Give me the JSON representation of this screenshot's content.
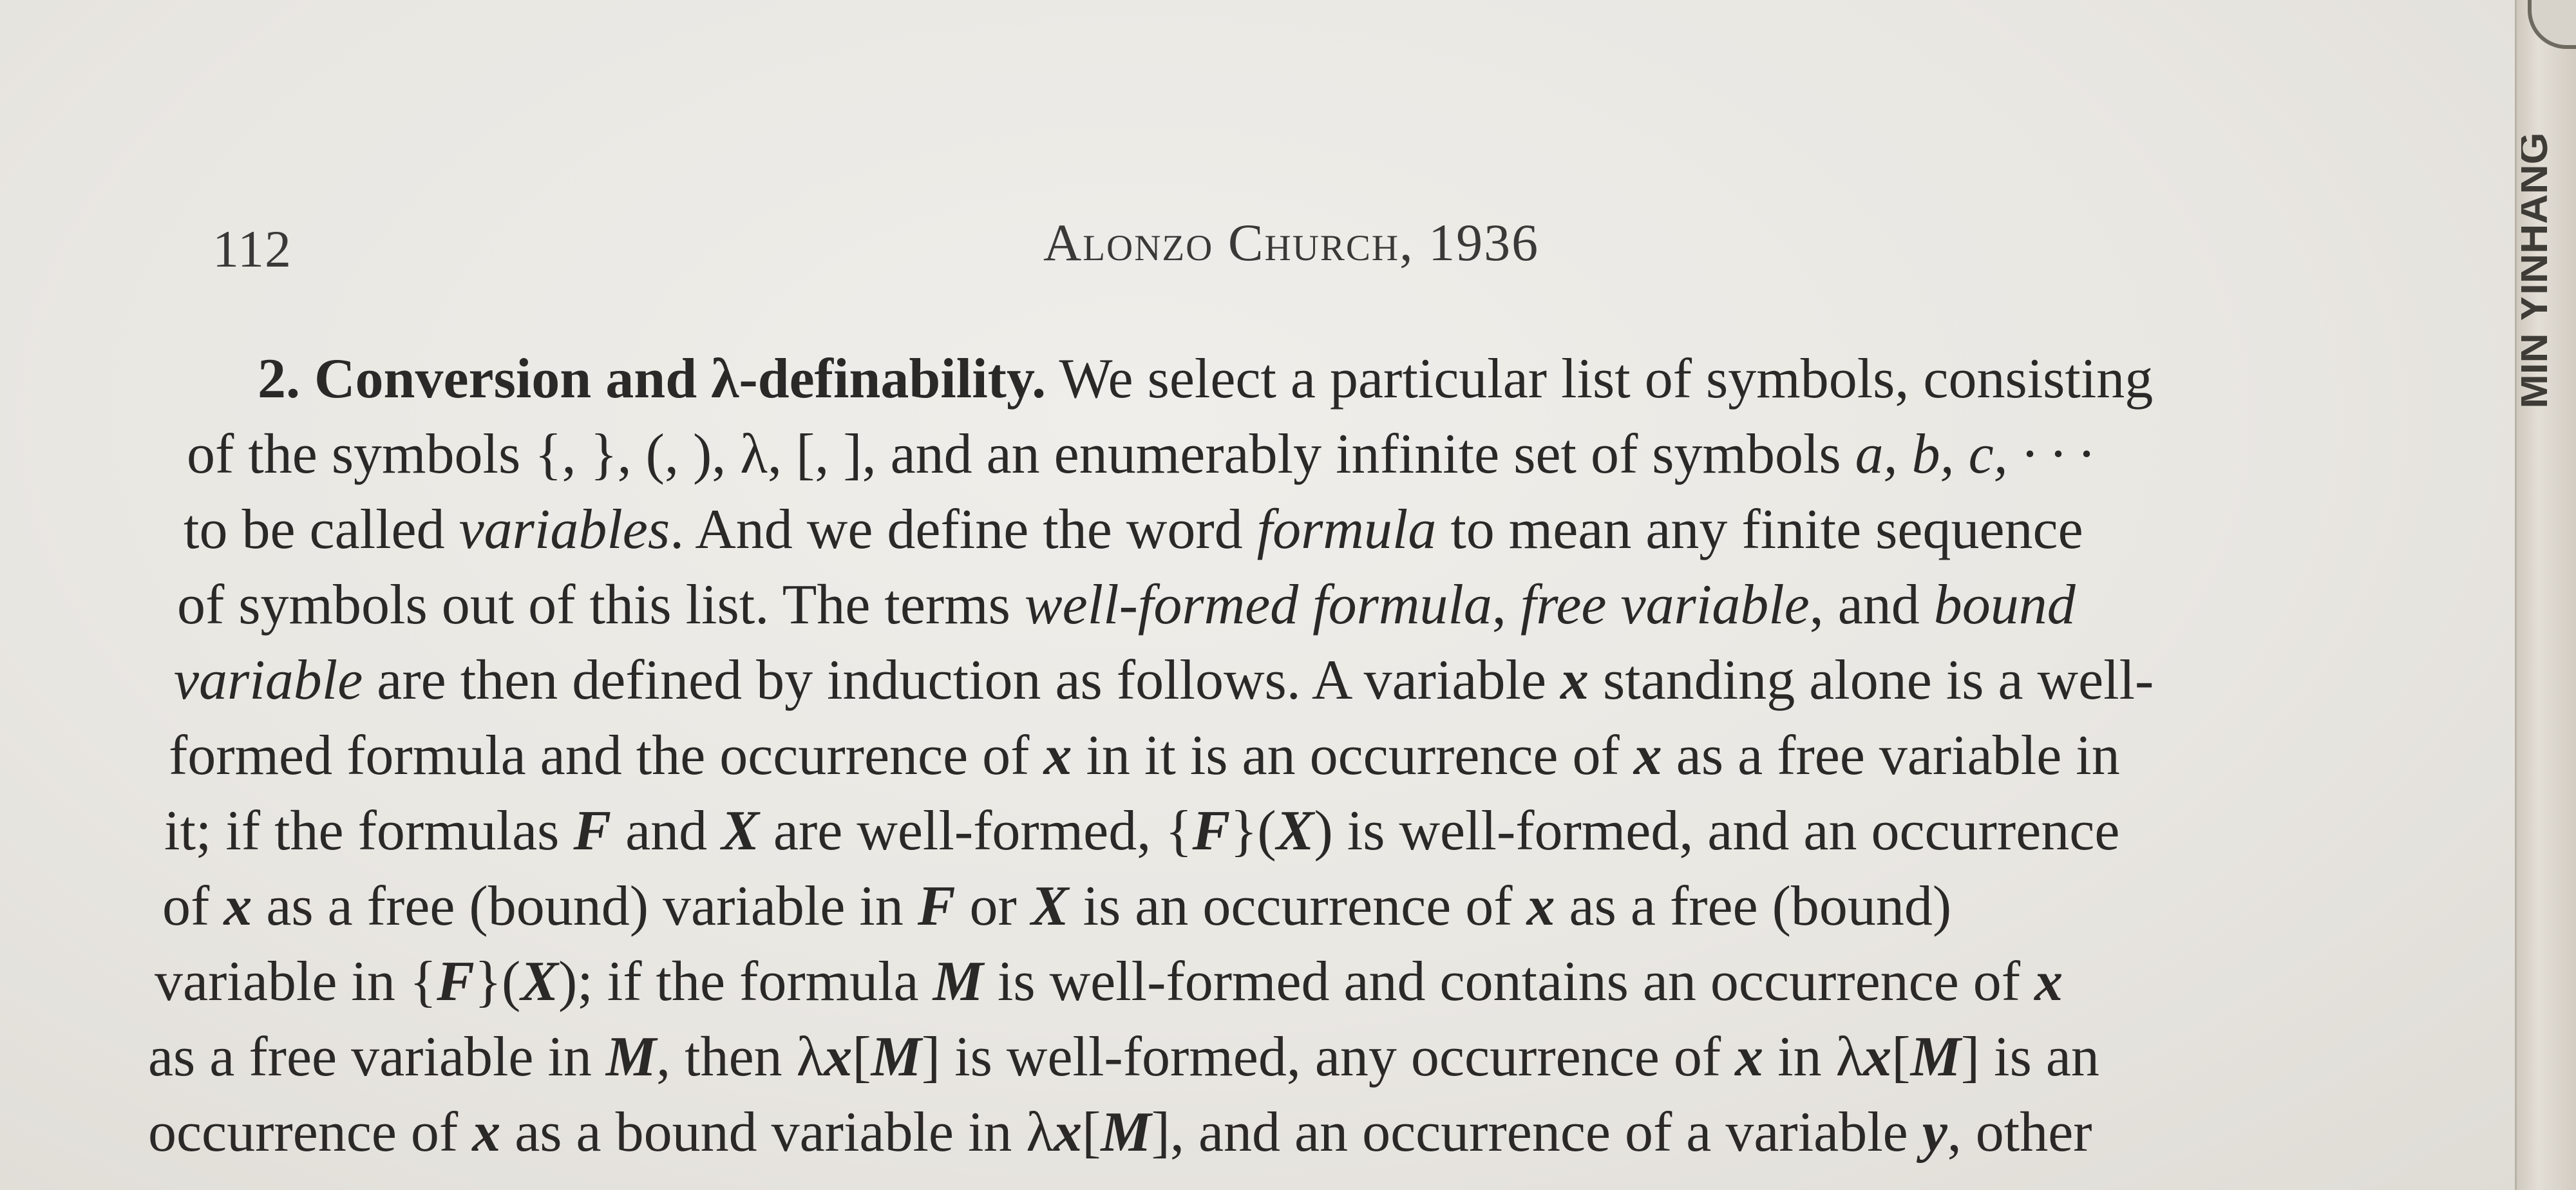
{
  "header": {
    "page_number": "112",
    "running_head": "Alonzo Church, 1936"
  },
  "text": {
    "l1_section_number": "2.",
    "l1_section_title": "Conversion and λ-definability.",
    "l1_rest": "We select a particular list of symbols, consisting",
    "l2_a": "of the symbols {, }, (, ), λ, [, ], and an enumerably infinite set of symbols ",
    "l2_b": "a, b, c, · · ·",
    "l3_a": "to be called ",
    "l3_b": "variables",
    "l3_c": ". And we define the word ",
    "l3_d": "formula",
    "l3_e": " to mean any finite sequence",
    "l4_a": "of symbols out of this list. The terms ",
    "l4_b": "well-formed formula",
    "l4_c": ", ",
    "l4_d": "free variable",
    "l4_e": ", and ",
    "l4_f": "bound",
    "l5_a": "variable",
    "l5_b": " are then defined by induction as follows. A variable ",
    "l5_c": "x",
    "l5_d": " standing alone is a well-",
    "l6_a": "formed formula and the occurrence of ",
    "l6_b": "x",
    "l6_c": " in it is an occurrence of ",
    "l6_d": "x",
    "l6_e": " as a free variable in",
    "l7_a": "it; if the formulas ",
    "l7_b": "F",
    "l7_c": " and ",
    "l7_d": "X",
    "l7_e": " are well-formed, {",
    "l7_f": "F",
    "l7_g": "}(",
    "l7_h": "X",
    "l7_i": ") is well-formed, and an occurrence",
    "l8_a": "of ",
    "l8_b": "x",
    "l8_c": " as a free (bound) variable in ",
    "l8_d": "F",
    "l8_e": " or ",
    "l8_f": "X",
    "l8_g": " is an occurrence of ",
    "l8_h": "x",
    "l8_i": " as a free (bound)",
    "l9_a": "variable in {",
    "l9_b": "F",
    "l9_c": "}(",
    "l9_d": "X",
    "l9_e": "); if the formula ",
    "l9_f": "M",
    "l9_g": " is well-formed and contains an occurrence of ",
    "l9_h": "x",
    "l10_a": "as a free variable in ",
    "l10_b": "M",
    "l10_c": ", then λ",
    "l10_d": "x",
    "l10_e": "[",
    "l10_f": "M",
    "l10_g": "] is well-formed, any occurrence of ",
    "l10_h": "x",
    "l10_i": " in λ",
    "l10_j": "x",
    "l10_k": "[",
    "l10_l": "M",
    "l10_m": "] is an",
    "l11_a": "occurrence of ",
    "l11_b": "x",
    "l11_c": " as a bound variable in λ",
    "l11_d": "x",
    "l11_e": "[",
    "l11_f": "M",
    "l11_g": "], and an occurrence of a variable ",
    "l11_h": "y",
    "l11_i": ", other"
  },
  "spine": {
    "sticker_text": "MIN YINHANG"
  },
  "colors": {
    "paper": "#ebe9e4",
    "ink": "#2a2928"
  }
}
